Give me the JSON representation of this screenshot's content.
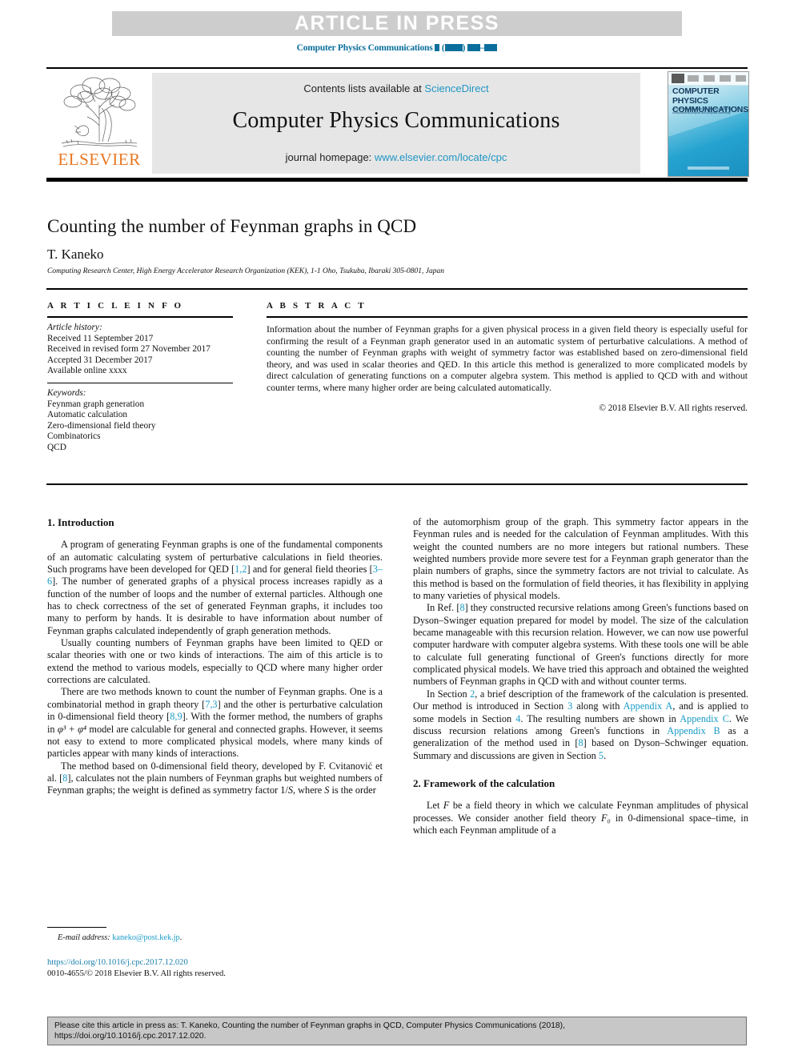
{
  "banner": {
    "text": "ARTICLE IN PRESS"
  },
  "running_citation": {
    "journal": "Computer Physics Communications",
    "volume_placeholder": "▮",
    "year_placeholder": "▮▮▮▮",
    "pages_placeholder": "▮▮▮–▮▮▮",
    "full": "Computer Physics Communications ▮ (▮▮▮▮) ▮▮▮–▮▮▮"
  },
  "masthead": {
    "publisher_logo_label": "ELSEVIER",
    "contents_prefix": "Contents lists available at ",
    "contents_link": "ScienceDirect",
    "journal_name": "Computer Physics Communications",
    "homepage_prefix": "journal homepage: ",
    "homepage_link": "www.elsevier.com/locate/cpc",
    "cover": {
      "title_line1": "COMPUTER PHYSICS",
      "title_line2": "COMMUNICATIONS",
      "subtitle": "An international journal and program library for computational physics and physical chemistry"
    }
  },
  "article": {
    "title": "Counting the number of Feynman graphs in QCD",
    "author": "T. Kaneko",
    "affiliation": "Computing Research Center, High Energy Accelerator Research Organization (KEK), 1-1 Oho, Tsukuba, Ibaraki 305-0801, Japan"
  },
  "article_info": {
    "heading": "A R T I C L E   I N F O",
    "history_label": "Article history:",
    "history": [
      "Received 11 September 2017",
      "Received in revised form 27 November 2017",
      "Accepted 31 December 2017",
      "Available online xxxx"
    ],
    "keywords_label": "Keywords:",
    "keywords": [
      "Feynman graph generation",
      "Automatic calculation",
      "Zero-dimensional field theory",
      "Combinatorics",
      "QCD"
    ]
  },
  "abstract": {
    "heading": "A B S T R A C T",
    "text": "Information about the number of Feynman graphs for a given physical process in a given field theory is especially useful for confirming the result of a Feynman graph generator used in an automatic system of perturbative calculations. A method of counting the number of Feynman graphs with weight of symmetry factor was established based on zero-dimensional field theory, and was used in scalar theories and QED. In this article this method is generalized to more complicated models by direct calculation of generating functions on a computer algebra system. This method is applied to QCD with and without counter terms, where many higher order are being calculated automatically.",
    "copyright": "© 2018 Elsevier B.V. All rights reserved."
  },
  "sections": {
    "introduction_heading": "1. Introduction",
    "framework_heading": "2. Framework of the calculation"
  },
  "body": {
    "left": {
      "p1_a": "A program of generating Feynman graphs is one of the fundamental components of an automatic calculating system of perturbative calculations in field theories. Such programs have been developed for QED [",
      "p1_ref1": "1,2",
      "p1_b": "] and for general field theories [",
      "p1_ref2": "3–6",
      "p1_c": "]. The number of generated graphs of a physical process increases rapidly as a function of the number of loops and the number of external particles. Although one has to check correctness of the set of generated Feynman graphs, it includes too many to perform by hands. It is desirable to have information about number of Feynman graphs calculated independently of graph generation methods.",
      "p2": "Usually counting numbers of Feynman graphs have been limited to QED or scalar theories with one or two kinds of interactions. The aim of this article is to extend the method to various models, especially to QCD where many higher order corrections are calculated.",
      "p3_a": "There are two methods known to count the number of Feynman graphs. One is a combinatorial method in graph theory [",
      "p3_ref1": "7,3",
      "p3_b": "] and the other is perturbative calculation in 0-dimensional field theory [",
      "p3_ref2": "8,9",
      "p3_c": "]. With the former method, the numbers of graphs in ",
      "p3_math": "φ³ + φ⁴",
      "p3_d": " model are calculable for general and connected graphs. However, it seems not easy to extend to more complicated physical models, where many kinds of particles appear with many kinds of interactions.",
      "p4_a": "The method based on 0-dimensional field theory, developed by F. Cvitanović et al. [",
      "p4_ref1": "8",
      "p4_b": "], calculates not the plain numbers of Feynman graphs but weighted numbers of Feynman graphs; the weight is defined as symmetry factor 1/",
      "p4_math1": "S",
      "p4_c": ", where ",
      "p4_math2": "S",
      "p4_d": " is the order"
    },
    "right": {
      "p1": "of the automorphism group of the graph. This symmetry factor appears in the Feynman rules and is needed for the calculation of Feynman amplitudes. With this weight the counted numbers are no more integers but rational numbers. These weighted numbers provide more severe test for a Feynman graph generator than the plain numbers of graphs, since the symmetry factors are not trivial to calculate. As this method is based on the formulation of field theories, it has flexibility in applying to many varieties of physical models.",
      "p2_a": "In Ref. [",
      "p2_ref1": "8",
      "p2_b": "] they constructed recursive relations among Green's functions based on Dyson–Swinger equation prepared for model by model. The size of the calculation became manageable with this recursion relation. However, we can now use powerful computer hardware with computer algebra systems. With these tools one will be able to calculate full generating functional of Green's functions directly for more complicated physical models. We have tried this approach and obtained the weighted numbers of Feynman graphs in QCD with and without counter terms.",
      "p3_a": "In Section ",
      "p3_ref1": "2",
      "p3_b": ", a brief description of the framework of the calculation is presented. Our method is introduced in Section ",
      "p3_ref2": "3",
      "p3_c": " along with ",
      "p3_ref3": "Appendix A",
      "p3_d": ", and is applied to some models in Section ",
      "p3_ref4": "4",
      "p3_e": ". The resulting numbers are shown in ",
      "p3_ref5": "Appendix C",
      "p3_f": ". We discuss recursion relations among Green's functions in ",
      "p3_ref6": "Appendix B",
      "p3_g": " as a generalization of the method used in [",
      "p3_ref7": "8",
      "p3_h": "] based on Dyson–Schwinger equation. Summary and discussions are given in Section ",
      "p3_ref8": "5",
      "p3_i": ".",
      "p4_a": "Let ",
      "p4_math1": "F",
      "p4_b": " be a field theory in which we calculate Feynman amplitudes of physical processes. We consider another field theory ",
      "p4_math2": "F₀",
      "p4_c": " in 0-dimensional space–time, in which each Feynman amplitude of a"
    }
  },
  "footnote": {
    "label": "E-mail address:",
    "email": "kaneko@post.kek.jp",
    "trailing": "."
  },
  "doi": "https://doi.org/10.1016/j.cpc.2017.12.020",
  "issn_line": "0010-4655/© 2018 Elsevier B.V. All rights reserved.",
  "cite_box": {
    "line1": "Please cite this article in press as: T. Kaneko, Counting the number of Feynman graphs in QCD, Computer Physics Communications (2018),",
    "line2": "https://doi.org/10.1016/j.cpc.2017.12.020."
  },
  "colors": {
    "link_blue": "#1a9bc7",
    "running_head_blue": "#0b6f9d",
    "elsevier_orange": "#e87722",
    "banner_gray": "#cdcdcd",
    "panel_gray": "#e6e6e6",
    "cite_box_gray": "#c7c7c7"
  }
}
